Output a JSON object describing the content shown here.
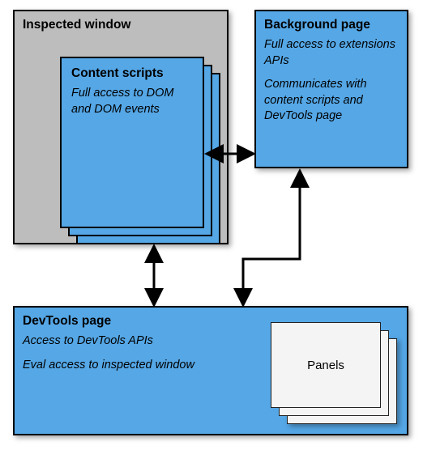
{
  "inspected": {
    "title": "Inspected window",
    "content_scripts": {
      "title": "Content scripts",
      "desc": "Full access to DOM and DOM events"
    }
  },
  "background": {
    "title": "Background page",
    "desc1": "Full access to extensions APIs",
    "desc2": "Communicates with content scripts and DevTools page"
  },
  "devtools": {
    "title": "DevTools page",
    "desc1": "Access to DevTools APIs",
    "desc2": "Eval access to inspected window",
    "panels_label": "Panels"
  },
  "colors": {
    "blue": "#55a7e6",
    "gray": "#bdbdbd"
  }
}
